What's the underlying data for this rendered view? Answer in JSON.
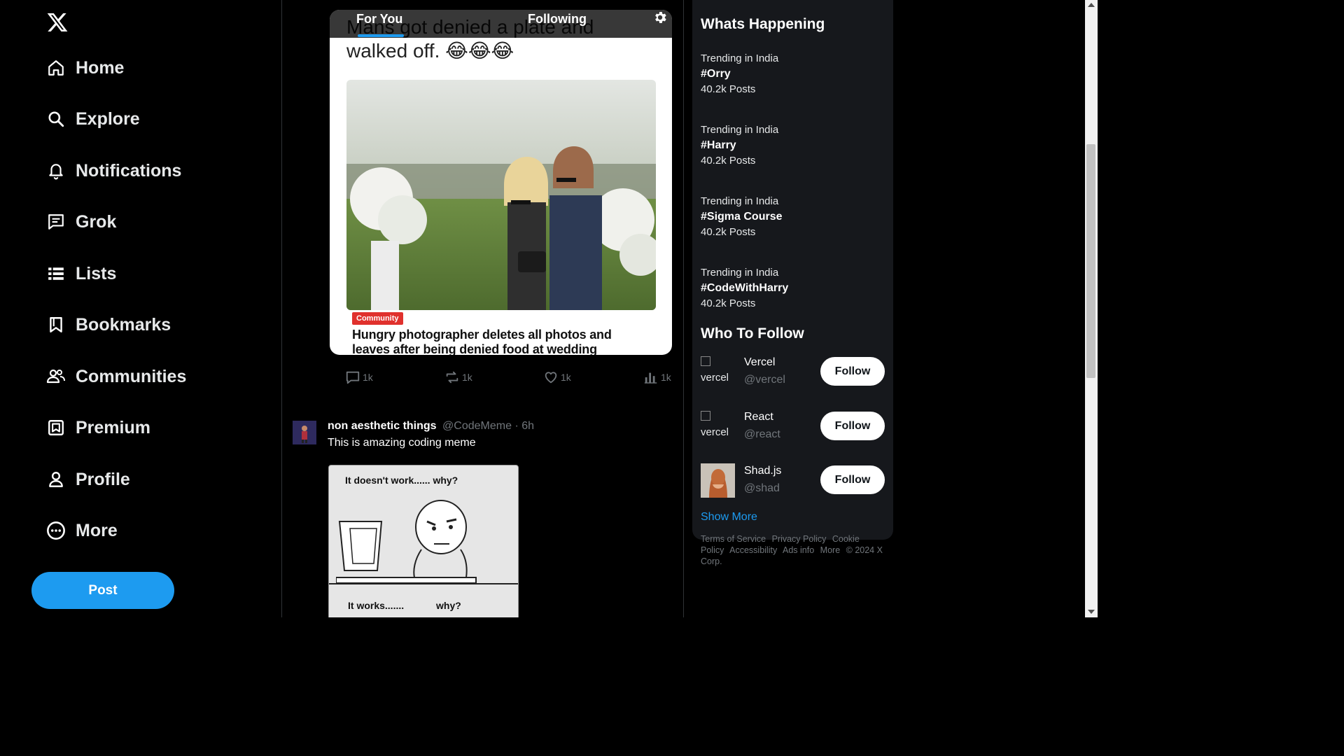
{
  "nav": {
    "items": [
      {
        "label": "Home",
        "icon": "home-icon"
      },
      {
        "label": "Explore",
        "icon": "search-icon"
      },
      {
        "label": "Notifications",
        "icon": "bell-icon"
      },
      {
        "label": "Grok",
        "icon": "message-icon"
      },
      {
        "label": "Lists",
        "icon": "list-icon"
      },
      {
        "label": "Bookmarks",
        "icon": "bookmark-icon"
      },
      {
        "label": "Communities",
        "icon": "people-icon"
      },
      {
        "label": "Premium",
        "icon": "premium-icon"
      },
      {
        "label": "Profile",
        "icon": "person-icon"
      },
      {
        "label": "More",
        "icon": "more-circle-icon"
      }
    ],
    "post_label": "Post"
  },
  "feed": {
    "tabs": [
      "For You",
      "Following"
    ],
    "post1": {
      "caption": "Mans got denied a plate and walked off. 😂😂😂",
      "chip": "Community",
      "headline": "Hungry photographer deletes all photos and leaves after being denied food at wedding",
      "stats": {
        "replies": "1k",
        "reposts": "1k",
        "likes": "1k",
        "views": "1k"
      }
    },
    "post2": {
      "name": "non aesthetic things",
      "handle": "@CodeMeme",
      "time": "6h",
      "text": "This is amazing coding meme",
      "meme_top": "It doesn't work...... why?",
      "meme_bottom_left": "It works.......",
      "meme_bottom_right": "why?"
    }
  },
  "sidebar": {
    "trending_title": "Whats Happening",
    "trends": [
      {
        "context": "Trending in India",
        "tag": "#Orry",
        "count": "40.2k Posts"
      },
      {
        "context": "Trending in India",
        "tag": "#Harry",
        "count": "40.2k Posts"
      },
      {
        "context": "Trending in India",
        "tag": "#Sigma Course",
        "count": "40.2k Posts"
      },
      {
        "context": "Trending in India",
        "tag": "#CodeWithHarry",
        "count": "40.2k Posts"
      }
    ],
    "follow_title": "Who To Follow",
    "follow": [
      {
        "name": "Vercel",
        "handle": "@vercel",
        "img_alt": "vercel",
        "button": "Follow"
      },
      {
        "name": "React",
        "handle": "@react",
        "img_alt": "vercel",
        "button": "Follow"
      },
      {
        "name": "Shad.js",
        "handle": "@shad",
        "img_alt": "",
        "button": "Follow"
      }
    ],
    "show_more": "Show More",
    "footer": [
      "Terms of Service",
      "Privacy Policy",
      "Cookie Policy",
      "Accessibility",
      "Ads info",
      "More",
      "© 2024 X Corp."
    ]
  },
  "colors": {
    "accent": "#1d9bf0",
    "background": "#000000",
    "panel": "#16181c",
    "muted": "#71767b"
  }
}
